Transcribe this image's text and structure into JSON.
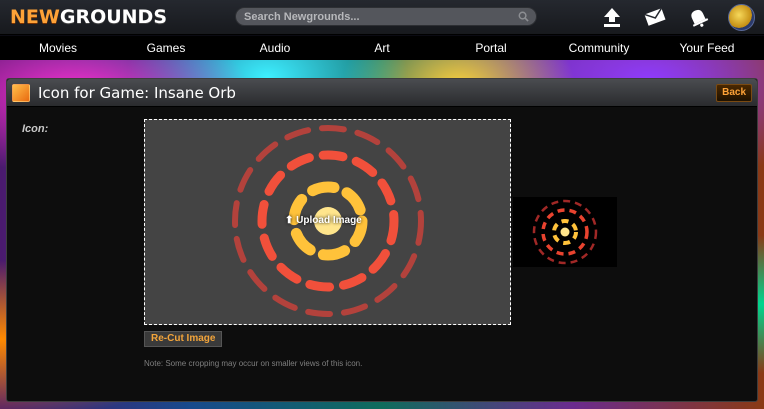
{
  "header": {
    "logo_new": "NEW",
    "logo_grounds": "GROUNDS",
    "search_placeholder": "Search Newgrounds..."
  },
  "icons": {
    "search": "search-icon",
    "upload": "upload-icon",
    "mail": "mail-icon",
    "notifications": "bell-icon",
    "avatar": "avatar"
  },
  "nav": [
    "Movies",
    "Games",
    "Audio",
    "Art",
    "Portal",
    "Community",
    "Your Feed"
  ],
  "panel": {
    "title": "Icon for Game: Insane Orb",
    "back_label": "Back",
    "field_label": "Icon:",
    "upload_label": "Upload Image",
    "recut_label": "Re-Cut Image",
    "note": "Note: Some cropping may occur on smaller views of this icon."
  },
  "colors": {
    "accent": "#fda238",
    "orb_inner": "#ffc23a",
    "orb_mid": "#f5572c",
    "orb_outer": "#d8423a"
  }
}
